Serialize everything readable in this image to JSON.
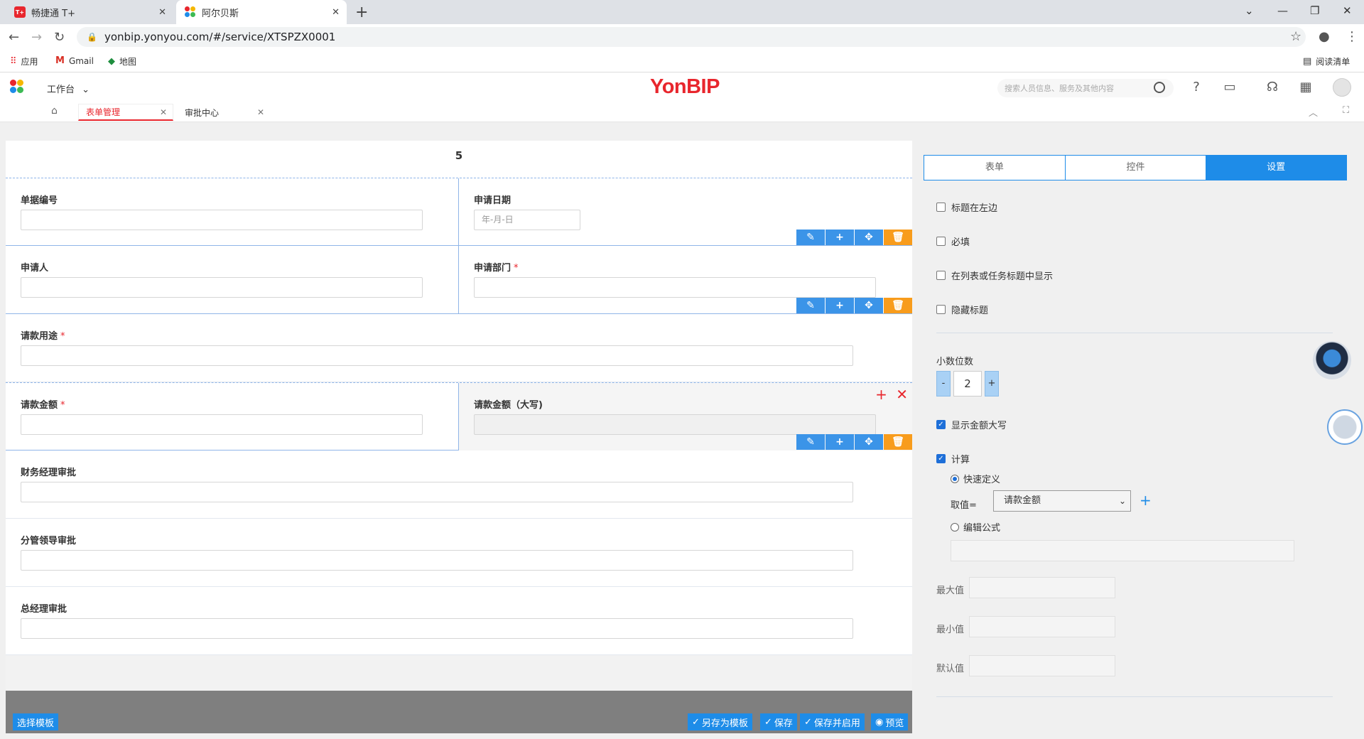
{
  "browser": {
    "tabs": [
      {
        "title": "畅捷通 T+",
        "icon": "T+"
      },
      {
        "title": "阿尔贝斯",
        "icon": "yonbip-dots"
      }
    ],
    "url": "yonbip.yonyou.com/#/service/XTSPZX0001",
    "bookmarks": [
      "应用",
      "Gmail",
      "地图"
    ],
    "reading_list": "阅读清单"
  },
  "app": {
    "workbench": "工作台",
    "brand": "YonBIP",
    "search_placeholder": "搜索人员信息、服务及其他内容",
    "page_tabs": [
      "表单管理",
      "审批中心"
    ]
  },
  "form": {
    "title": "5",
    "fields": {
      "doc_no": {
        "label": "单据编号"
      },
      "apply_date": {
        "label": "申请日期",
        "placeholder": "年-月-日"
      },
      "applicant": {
        "label": "申请人"
      },
      "dept": {
        "label": "申请部门",
        "required": "*"
      },
      "purpose": {
        "label": "请款用途",
        "required": "*"
      },
      "amount": {
        "label": "请款金额",
        "required": "*"
      },
      "amount_upper": {
        "label": "请款金额（大写)"
      },
      "fin_mgr": {
        "label": "财务经理审批"
      },
      "leader": {
        "label": "分管领导审批"
      },
      "gm": {
        "label": "总经理审批"
      }
    },
    "bottom": {
      "template": "选择模板",
      "save_as": "另存为模板",
      "save": "保存",
      "save_enable": "保存并启用",
      "preview": "预览"
    }
  },
  "panel": {
    "tabs": [
      "表单",
      "控件",
      "设置"
    ],
    "active_tab": "设置",
    "options": [
      {
        "label": "标题在左边",
        "checked": false
      },
      {
        "label": "必填",
        "checked": false
      },
      {
        "label": "在列表或任务标题中显示",
        "checked": false
      },
      {
        "label": "隐藏标题",
        "checked": false
      }
    ],
    "decimal_label": "小数位数",
    "decimal_minus": "-",
    "decimal_value": "2",
    "decimal_plus": "+",
    "show_upper": {
      "label": "显示金额大写",
      "checked": true
    },
    "calc": {
      "label": "计算",
      "checked": true
    },
    "quick_define": "快速定义",
    "take_value": "取值=",
    "take_value_selected": "请款金额",
    "edit_formula": "编辑公式",
    "max_label": "最大值",
    "min_label": "最小值",
    "default_label": "默认值"
  }
}
